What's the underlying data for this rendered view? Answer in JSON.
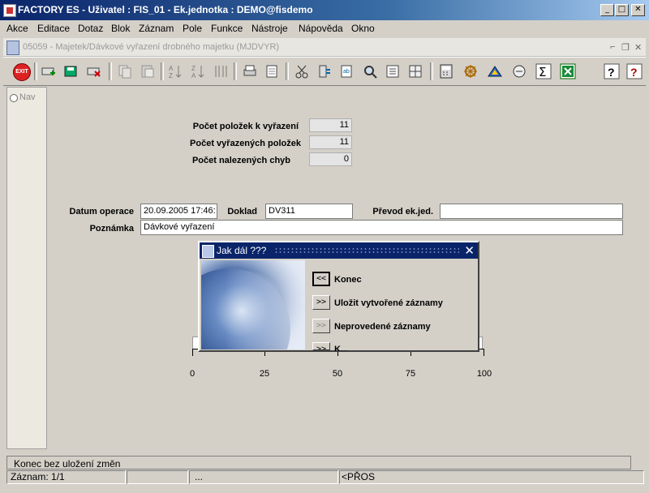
{
  "window": {
    "title": "FACTORY ES - Uživatel : FIS_01 - Ek.jednotka : DEMO@fisdemo",
    "minimize": "_",
    "maximize": "□",
    "close": "✕"
  },
  "menu": [
    "Akce",
    "Editace",
    "Dotaz",
    "Blok",
    "Záznam",
    "Pole",
    "Funkce",
    "Nástroje",
    "Nápověda",
    "Okno"
  ],
  "inner_window": {
    "title": "05059 - Majetek/Dávkové vyřazení drobného majetku (MJDVYR)"
  },
  "toolbar": {
    "exit_label": "EXIT",
    "icons": [
      "exit-icon",
      "insert-record-icon",
      "save-icon",
      "delete-record-icon",
      "copy-icon",
      "paste-icon",
      "sort-asc-icon",
      "sort-desc-icon",
      "sort-icon",
      "print-icon",
      "print-preview-icon",
      "cut-icon",
      "clip-icon",
      "edit-icon",
      "find-icon",
      "list-icon",
      "list2-icon",
      "calculator-icon",
      "wheel-icon",
      "triangle-icon",
      "note-icon",
      "sum-icon",
      "excel-icon",
      "help-icon",
      "context-help-icon"
    ]
  },
  "nav": {
    "label": "Nav"
  },
  "form": {
    "count_to_retire_label": "Počet položek k vyřazení",
    "count_to_retire_value": "11",
    "count_retired_label": "Počet vyřazených položek",
    "count_retired_value": "11",
    "errors_label": "Počet nalezených chyb",
    "errors_value": "0",
    "date_label": "Datum operace",
    "date_value": "20.09.2005 17:46:",
    "doc_label": "Doklad",
    "doc_value": "DV311",
    "transfer_label": "Převod ek.jed.",
    "transfer_value": "",
    "note_label": "Poznámka",
    "note_value": "Dávkové vyřazení"
  },
  "progress": {
    "ticks": [
      "0",
      "25",
      "50",
      "75",
      "100"
    ]
  },
  "dialog": {
    "title": "Jak dál ???",
    "close": "✕",
    "buttons": [
      {
        "arrow": "<<",
        "label": "Konec"
      },
      {
        "arrow": ">>",
        "label": "Uložit vytvořené záznamy"
      },
      {
        "arrow": ">>",
        "label": "Neprovedené záznamy"
      },
      {
        "arrow": ">>",
        "label": "K..."
      }
    ]
  },
  "status": {
    "message": "Konec bez uložení změn",
    "record": "Záznam: 1/1",
    "dots": "...",
    "mode": "<PŘOS"
  },
  "colors": {
    "titlebar": "#0a246a",
    "face": "#d4d0c8"
  }
}
